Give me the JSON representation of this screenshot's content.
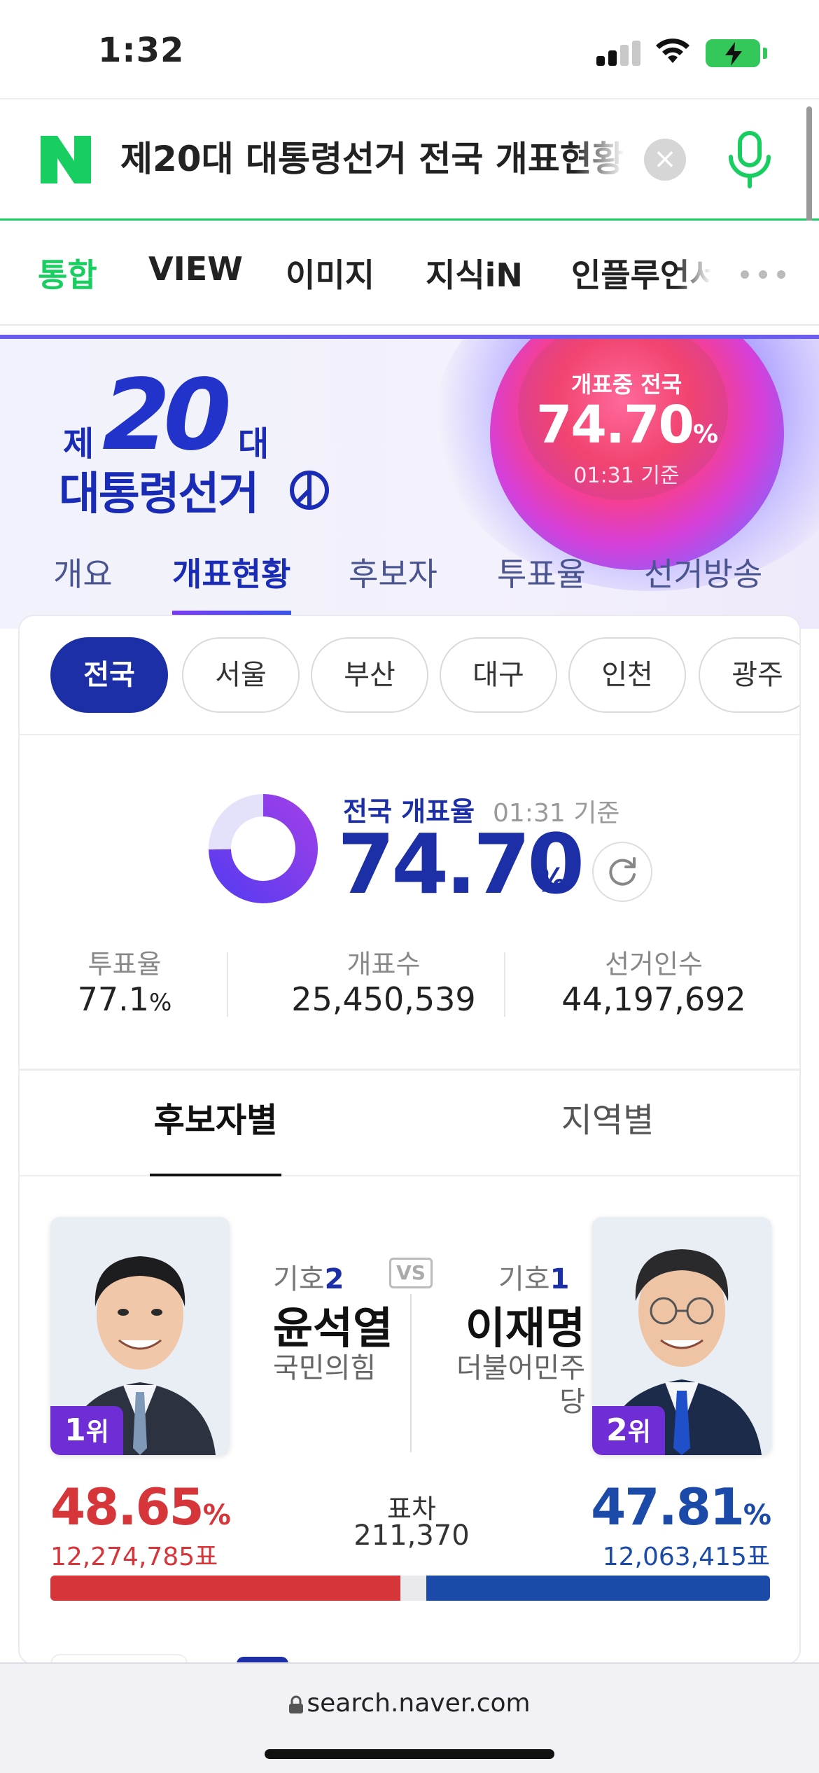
{
  "status_bar": {
    "time": "1:32"
  },
  "search": {
    "query": "제20대 대통령선거 전국 개표현황",
    "clear": "×"
  },
  "nav_tabs": [
    "통합",
    "VIEW",
    "이미지",
    "지식iN",
    "인플루언서"
  ],
  "hero": {
    "logo_je": "제",
    "logo_number": "20",
    "logo_dae": "대",
    "logo_title": "대통령선거",
    "orb_label": "개표중 전국",
    "orb_rate": "74.70",
    "orb_pct": "%",
    "orb_time": "01:31 기준",
    "tabs": [
      "개요",
      "개표현황",
      "후보자",
      "투표율",
      "선거방송"
    ]
  },
  "regions": [
    "전국",
    "서울",
    "부산",
    "대구",
    "인천",
    "광주"
  ],
  "count_rate": {
    "label": "전국 개표율",
    "time": "01:31 기준",
    "value": "74.70",
    "pct": "%",
    "progress": 74.7
  },
  "stats": [
    {
      "label": "투표율",
      "value": "77.1",
      "unit": "%"
    },
    {
      "label": "개표수",
      "value": "25,450,539",
      "unit": ""
    },
    {
      "label": "선거인수",
      "value": "44,197,692",
      "unit": ""
    }
  ],
  "sub_tabs": [
    "후보자별",
    "지역별"
  ],
  "candidates": {
    "left": {
      "number_prefix": "기호",
      "number": "2",
      "name": "윤석열",
      "party": "국민의힘",
      "rank_num": "1",
      "rank_suffix": "위",
      "pct": "48.65",
      "pct_sign": "%",
      "votes": "12,274,785표",
      "color": "#d6353a",
      "share": 48.65
    },
    "right": {
      "number_prefix": "기호",
      "number": "1",
      "name": "이재명",
      "party_line1": "더불어민주",
      "party_line2": "당",
      "rank_num": "2",
      "rank_suffix": "위",
      "pct": "47.81",
      "pct_sign": "%",
      "votes": "12,063,415표",
      "color": "#1b4aa8",
      "share": 47.81
    },
    "vs": "VS",
    "gap_label": "표차",
    "gap_value": "211,370"
  },
  "url_bar": {
    "domain": "search.naver.com"
  },
  "colors": {
    "naver_green": "#19ce60",
    "election_blue": "#1c2fa6",
    "rank_purple": "#6f2dd6"
  }
}
